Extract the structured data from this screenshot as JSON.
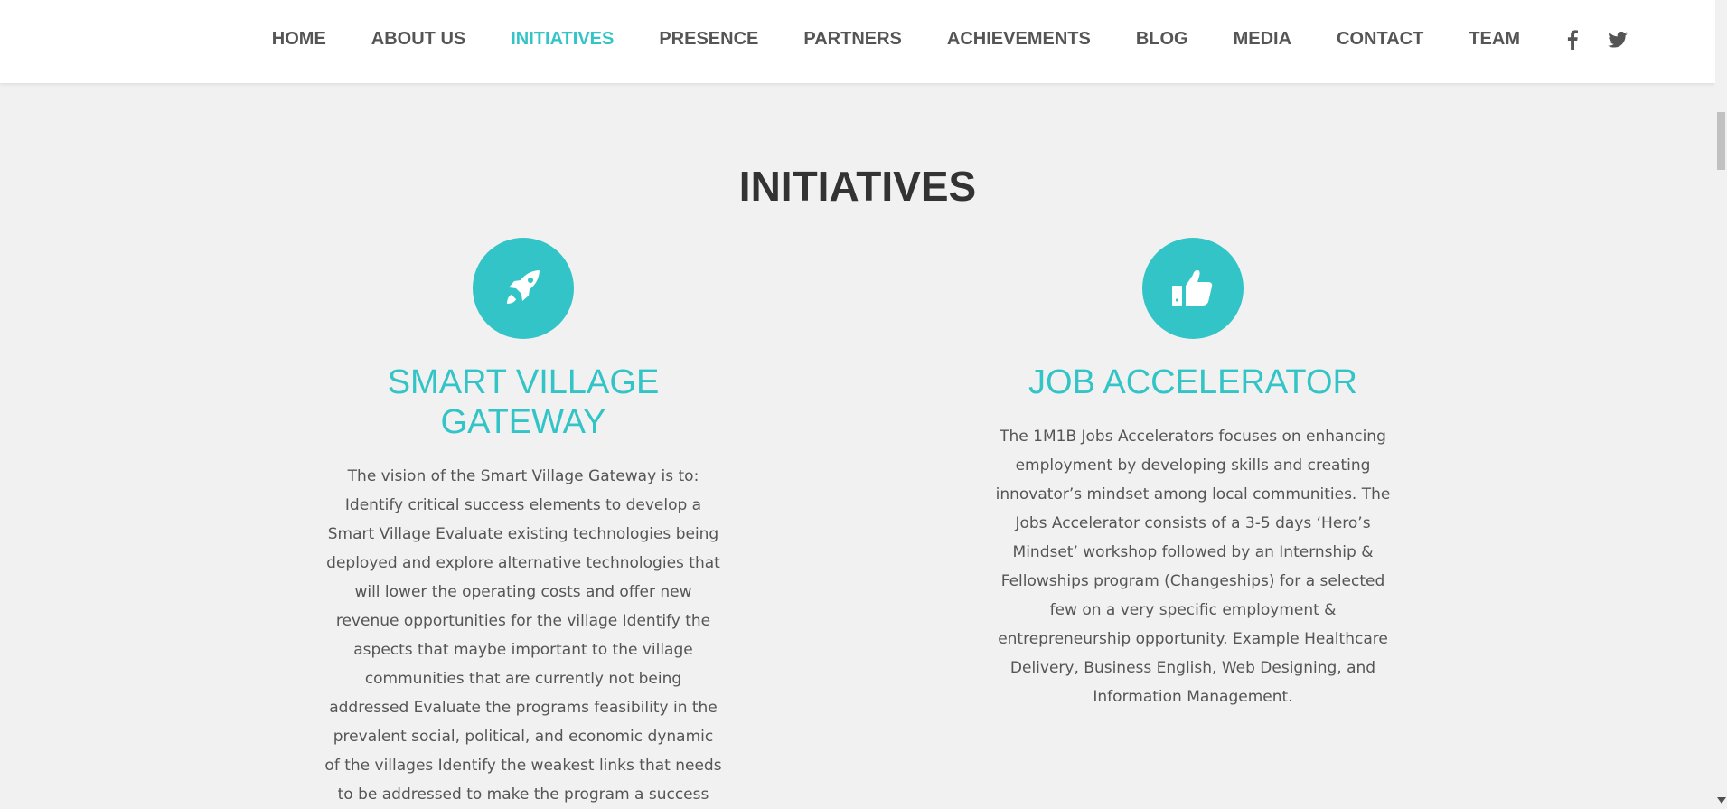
{
  "nav": {
    "items": [
      {
        "label": "HOME",
        "active": false
      },
      {
        "label": "ABOUT US",
        "active": false
      },
      {
        "label": "INITIATIVES",
        "active": true
      },
      {
        "label": "PRESENCE",
        "active": false
      },
      {
        "label": "PARTNERS",
        "active": false
      },
      {
        "label": "ACHIEVEMENTS",
        "active": false
      },
      {
        "label": "BLOG",
        "active": false
      },
      {
        "label": "MEDIA",
        "active": false
      },
      {
        "label": "CONTACT",
        "active": false
      },
      {
        "label": "TEAM",
        "active": false
      }
    ],
    "social": [
      "facebook-icon",
      "twitter-icon"
    ]
  },
  "section": {
    "title": "INITIATIVES"
  },
  "initiatives": [
    {
      "icon": "rocket-icon",
      "title": "SMART VILLAGE GATEWAY",
      "description": "The vision of the Smart Village Gateway is to: Identify critical success elements to develop a Smart Village Evaluate existing technologies being deployed and explore alternative technologies that will lower the operating costs and offer new revenue opportunities for the village Identify the aspects that maybe important to the village communities that are currently not being addressed Evaluate the programs feasibility in the prevalent social, political, and economic dynamic of the villages Identify the weakest links that needs to be addressed to make the program a success"
    },
    {
      "icon": "thumbs-up-icon",
      "title": "JOB ACCELERATOR",
      "description": "The 1M1B Jobs Accelerators focuses on enhancing employment by developing skills and creating innovator’s mindset among local communities. The Jobs Accelerator consists of a 3-5 days ‘Hero’s Mindset’ workshop followed by an Internship & Fellowships program (Changeships) for a selected few on a very specific employment & entrepreneurship opportunity. Example Healthcare Delivery, Business English, Web Designing, and Information Management."
    }
  ],
  "colors": {
    "accent": "#32c4c6",
    "text": "#555555",
    "heading": "#333333",
    "background": "#f1f1f1"
  }
}
